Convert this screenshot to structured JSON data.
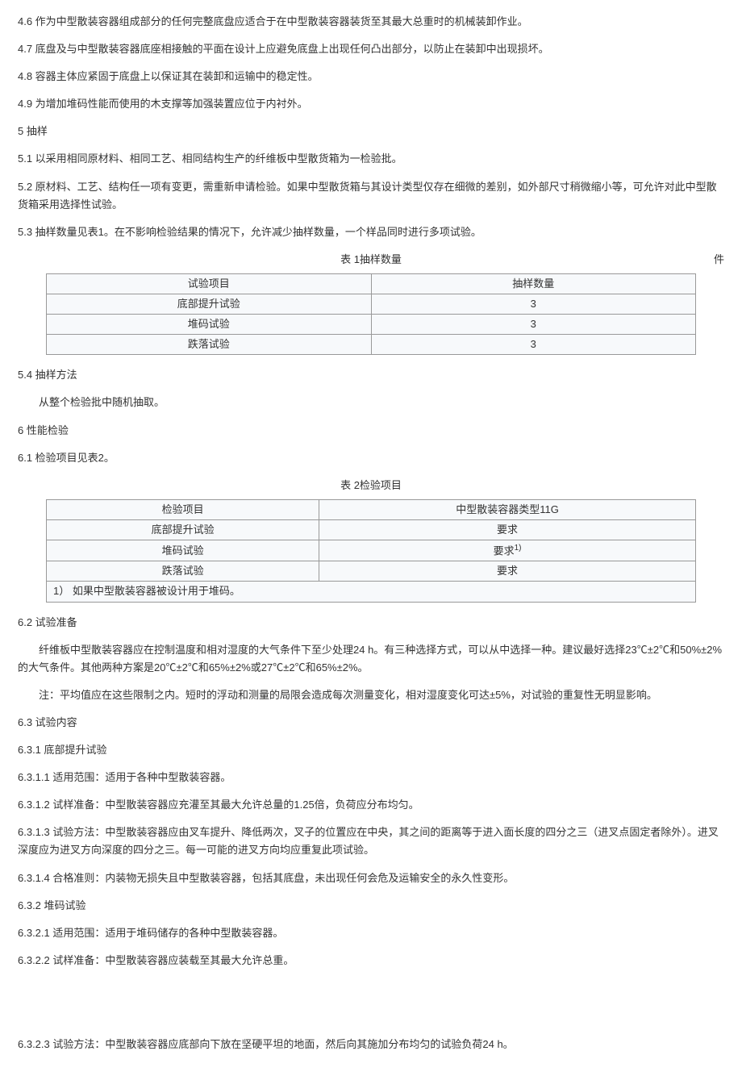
{
  "paras": {
    "p46": "4.6 作为中型散装容器组成部分的任何完整底盘应适合于在中型散装容器装货至其最大总重时的机械装卸作业。",
    "p47": "4.7 底盘及与中型散装容器底座相接触的平面在设计上应避免底盘上出现任何凸出部分，以防止在装卸中出现损坏。",
    "p48": "4.8 容器主体应紧固于底盘上以保证其在装卸和运输中的稳定性。",
    "p49": "4.9 为增加堆码性能而使用的木支撑等加强装置应位于内衬外。",
    "s5": "5 抽样",
    "p51": "5.1 以采用相同原材料、相同工艺、相同结构生产的纤维板中型散货箱为一检验批。",
    "p52": "5.2 原材料、工艺、结构任一项有变更，需重新申请检验。如果中型散货箱与其设计类型仅存在细微的差别，如外部尺寸稍微缩小等，可允许对此中型散货箱采用选择性试验。",
    "p53": "5.3 抽样数量见表1。在不影响检验结果的情况下，允许减少抽样数量，一个样品同时进行多项试验。",
    "t1_title": "表 1抽样数量",
    "t1_unit": "件",
    "t1_h1": "试验项目",
    "t1_h2": "抽样数量",
    "t1_r1c1": "底部提升试验",
    "t1_r1c2": "3",
    "t1_r2c1": "堆码试验",
    "t1_r2c2": "3",
    "t1_r3c1": "跌落试验",
    "t1_r3c2": "3",
    "p54": "5.4 抽样方法",
    "p54a": "从整个检验批中随机抽取。",
    "s6": "6 性能检验",
    "p61": "6.1 检验项目见表2。",
    "t2_title": "表 2检验项目",
    "t2_h1": "检验项目",
    "t2_h2": "中型散装容器类型11G",
    "t2_r1c1": "底部提升试验",
    "t2_r1c2": "要求",
    "t2_r2c1": "堆码试验",
    "t2_r2c2a": "要求",
    "t2_r2c2b": "1)",
    "t2_r3c1": "跌落试验",
    "t2_r3c2": "要求",
    "t2_note": "1） 如果中型散装容器被设计用于堆码。",
    "p62": "6.2 试验准备",
    "p62a": "纤维板中型散装容器应在控制温度和相对湿度的大气条件下至少处理24 h。有三种选择方式，可以从中选择一种。建议最好选择23℃±2℃和50%±2%的大气条件。其他两种方案是20℃±2℃和65%±2%或27℃±2℃和65%±2%。",
    "p62b": "注：平均值应在这些限制之内。短时的浮动和测量的局限会造成每次测量变化，相对湿度变化可达±5%，对试验的重复性无明显影响。",
    "p63": "6.3 试验内容",
    "p631": "6.3.1 底部提升试验",
    "p6311": "6.3.1.1 适用范围：适用于各种中型散装容器。",
    "p6312": "6.3.1.2 试样准备：中型散装容器应充灌至其最大允许总量的1.25倍，负荷应分布均匀。",
    "p6313": "6.3.1.3 试验方法：中型散装容器应由叉车提升、降低两次，叉子的位置应在中央，其之间的距离等于进入面长度的四分之三（进叉点固定者除外）。进叉深度应为进叉方向深度的四分之三。每一可能的进叉方向均应重复此项试验。",
    "p6314": "6.3.1.4 合格准则：内装物无损失且中型散装容器，包括其底盘，未出现任何会危及运输安全的永久性变形。",
    "p632": "6.3.2 堆码试验",
    "p6321": "6.3.2.1 适用范围：适用于堆码储存的各种中型散装容器。",
    "p6322": "6.3.2.2 试样准备：中型散装容器应装载至其最大允许总重。",
    "p6323": "6.3.2.3 试验方法：中型散装容器应底部向下放在坚硬平坦的地面，然后向其施加分布均匀的试验负荷24 h。"
  }
}
